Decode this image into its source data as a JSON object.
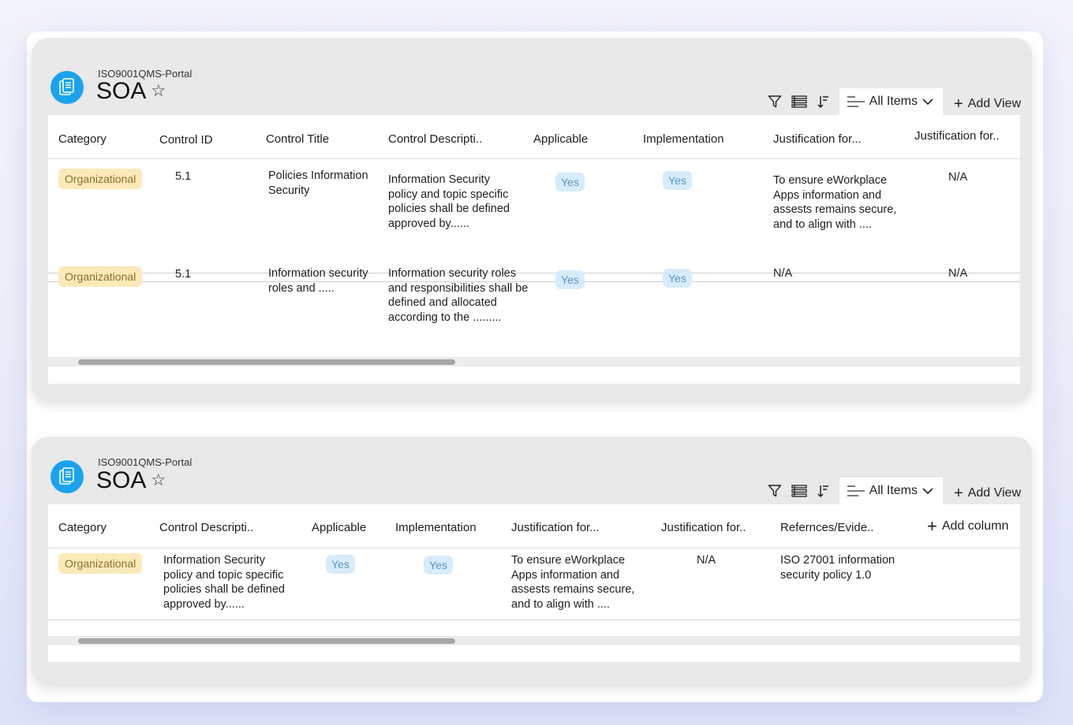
{
  "colors": {
    "brand": "#1aa3ec",
    "category_badge_bg": "#fbeab8",
    "category_badge_text": "#8a6f33",
    "yes_badge_bg": "#d7ecfb",
    "yes_badge_text": "#5a95c6"
  },
  "toolbar": {
    "icons": [
      "filter-icon",
      "group-by-icon",
      "sort-icon",
      "view-lines-icon",
      "chevron-down-icon"
    ],
    "view_label": "All Items",
    "add_view_label": "Add View"
  },
  "panels": [
    {
      "site_name": "ISO9001QMS-Portal",
      "title": "SOA",
      "favorite_icon": "star-icon",
      "columns": [
        "Category",
        "Control ID",
        "Control Title",
        "Control Descripti..",
        "Applicable",
        "Implementation",
        "Justification for...",
        "Justification for.."
      ],
      "rows": [
        {
          "category": "Organizational",
          "control_id": "5.1",
          "control_title": "Policies Information Security",
          "control_description": "Information Security policy and topic specific policies shall be defined approved by......",
          "applicable": "Yes",
          "implementation": "Yes",
          "justification_1": "To ensure eWorkplace Apps information and assests remains secure, and to align with ....",
          "justification_2": "N/A"
        },
        {
          "category": "Organizational",
          "control_id": "5.1",
          "control_title": "Information security roles and .....",
          "control_description": "Information security roles and responsibilities shall be defined and allocated according to the .........",
          "applicable": "Yes",
          "implementation": "Yes",
          "justification_1": "N/A",
          "justification_2": "N/A"
        }
      ]
    },
    {
      "site_name": "ISO9001QMS-Portal",
      "title": "SOA",
      "favorite_icon": "star-icon",
      "columns": [
        "Category",
        "Control Descripti..",
        "Applicable",
        "Implementation",
        "Justification for...",
        "Justification for..",
        "Refernces/Evide..",
        "Add column"
      ],
      "rows": [
        {
          "category": "Organizational",
          "control_description": "Information Security policy and topic specific policies shall be defined approved by......",
          "applicable": "Yes",
          "implementation": "Yes",
          "justification_1": "To ensure eWorkplace Apps information and assests remains secure, and to align with ....",
          "justification_2": "N/A",
          "references": "ISO 27001 information security policy 1.0"
        }
      ]
    }
  ]
}
